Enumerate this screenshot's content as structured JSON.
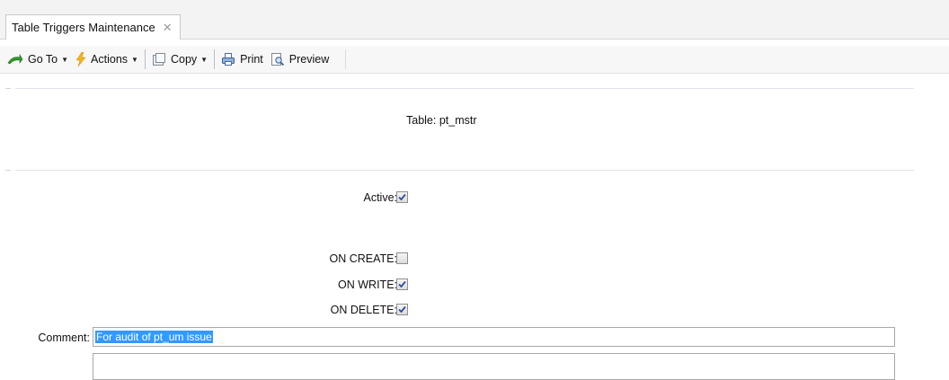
{
  "tab": {
    "title": "Table Triggers Maintenance",
    "close_glyph": "✕"
  },
  "toolbar": {
    "goto_label": "Go To",
    "actions_label": "Actions",
    "copy_label": "Copy",
    "print_label": "Print",
    "preview_label": "Preview",
    "caret": "▼"
  },
  "form": {
    "table_label": "Table:",
    "table_value": "pt_mstr",
    "active_label": "Active:",
    "active_checked": true,
    "on_create_label": "ON CREATE:",
    "on_create_checked": false,
    "on_write_label": "ON WRITE:",
    "on_write_checked": true,
    "on_delete_label": "ON DELETE:",
    "on_delete_checked": true,
    "comment_label": "Comment:",
    "comment_value": "For audit of pt_um issue",
    "comment2_value": ""
  },
  "colors": {
    "selection": "#3399ff",
    "check": "#2b4f9e"
  }
}
